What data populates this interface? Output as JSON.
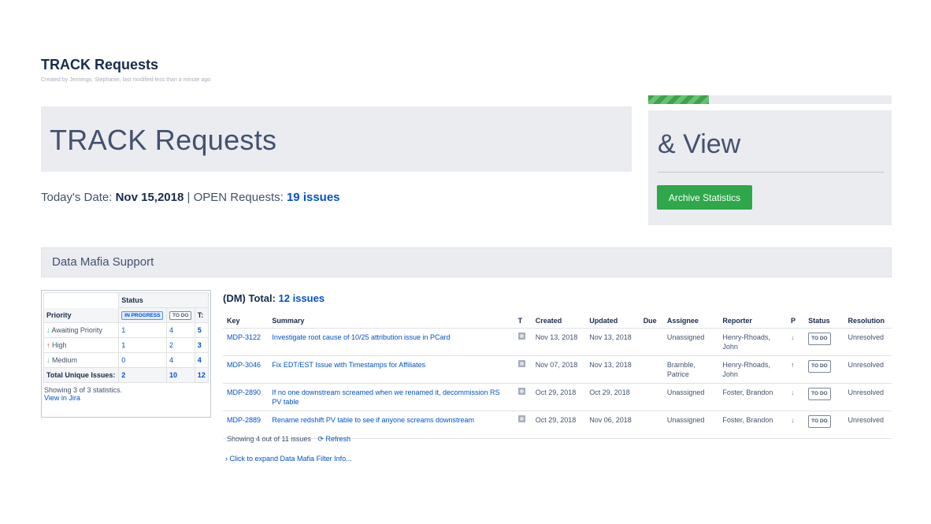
{
  "page": {
    "title": "TRACK Requests",
    "byline": "Created by Jennings, Stephanie, last modified less than a minute ago"
  },
  "hero": {
    "title": "TRACK Requests"
  },
  "progress": {
    "fraction": 0.25,
    "color": "#3ea24b"
  },
  "side_panel": {
    "title": "& View",
    "button_label": "Archive Statistics"
  },
  "date_line": {
    "date_label": "Today's Date:",
    "date_value": "Nov 15,2018",
    "separator": "|",
    "open_label": "OPEN Requests:",
    "open_value": "19 issues"
  },
  "section": {
    "title": "Data Mafia Support"
  },
  "stats": {
    "status_header": "Status",
    "priority_header": "Priority",
    "columns": [
      "IN PROGRESS",
      "TO DO",
      "T:"
    ],
    "rows": [
      {
        "label": "Awaiting Priority",
        "arrow": "↓",
        "values": [
          "1",
          "4",
          "5"
        ]
      },
      {
        "label": "High",
        "arrow": "↑",
        "values": [
          "1",
          "2",
          "3"
        ]
      },
      {
        "label": "Medium",
        "arrow": "↓",
        "values": [
          "0",
          "4",
          "4"
        ]
      }
    ],
    "total_label": "Total Unique Issues:",
    "totals": [
      "2",
      "10",
      "12"
    ],
    "showing": "Showing 3 of 3 statistics.",
    "view_link": "View in Jira"
  },
  "issues": {
    "total_label": "(DM) Total:",
    "total_value": "12 issues",
    "columns": [
      "Key",
      "Summary",
      "T",
      "Created",
      "Updated",
      "Due",
      "Assignee",
      "Reporter",
      "P",
      "Status",
      "Resolution"
    ],
    "rows": [
      {
        "key": "MDP-3122",
        "summary": "Investigate root cause of 10/25 attribution issue in PCard",
        "created": "Nov 13, 2018",
        "updated": "Nov 13, 2018",
        "due": "",
        "assignee": "Unassigned",
        "reporter": "Henry-Rhoads, John",
        "priority": "↓",
        "status": "TO DO",
        "resolution": "Unresolved"
      },
      {
        "key": "MDP-3046",
        "summary": "Fix EDT/EST Issue with Timestamps for Affiliates",
        "created": "Nov 07, 2018",
        "updated": "Nov 13, 2018",
        "due": "",
        "assignee": "Bramble, Patrice",
        "reporter": "Henry-Rhoads, John",
        "priority": "↑",
        "status": "TO DO",
        "resolution": "Unresolved"
      },
      {
        "key": "MDP-2890",
        "summary": "If no one downstream screamed when we renamed it, decommission RS PV table",
        "created": "Oct 29, 2018",
        "updated": "Oct 29, 2018",
        "due": "",
        "assignee": "Unassigned",
        "reporter": "Foster, Brandon",
        "priority": "↓",
        "status": "TO DO",
        "resolution": "Unresolved"
      },
      {
        "key": "MDP-2889",
        "summary": "Rename redshift PV table to see if anyone screams downstream",
        "created": "Oct 29, 2018",
        "updated": "Nov 06, 2018",
        "due": "",
        "assignee": "Unassigned",
        "reporter": "Foster, Brandon",
        "priority": "↓",
        "status": "TO DO",
        "resolution": "Unresolved"
      }
    ],
    "showing": "Showing 4 out of 11 issues",
    "refresh_label": "Refresh",
    "expand_link": "Click to expand Data Mafia Filter Info..."
  },
  "colors": {
    "accent": "#0052cc",
    "button": "#2ea84a",
    "panel": "#ebecf0"
  },
  "icons": {
    "type": "task-icon",
    "refresh": "refresh-icon",
    "expand": "chevron-right-icon"
  }
}
